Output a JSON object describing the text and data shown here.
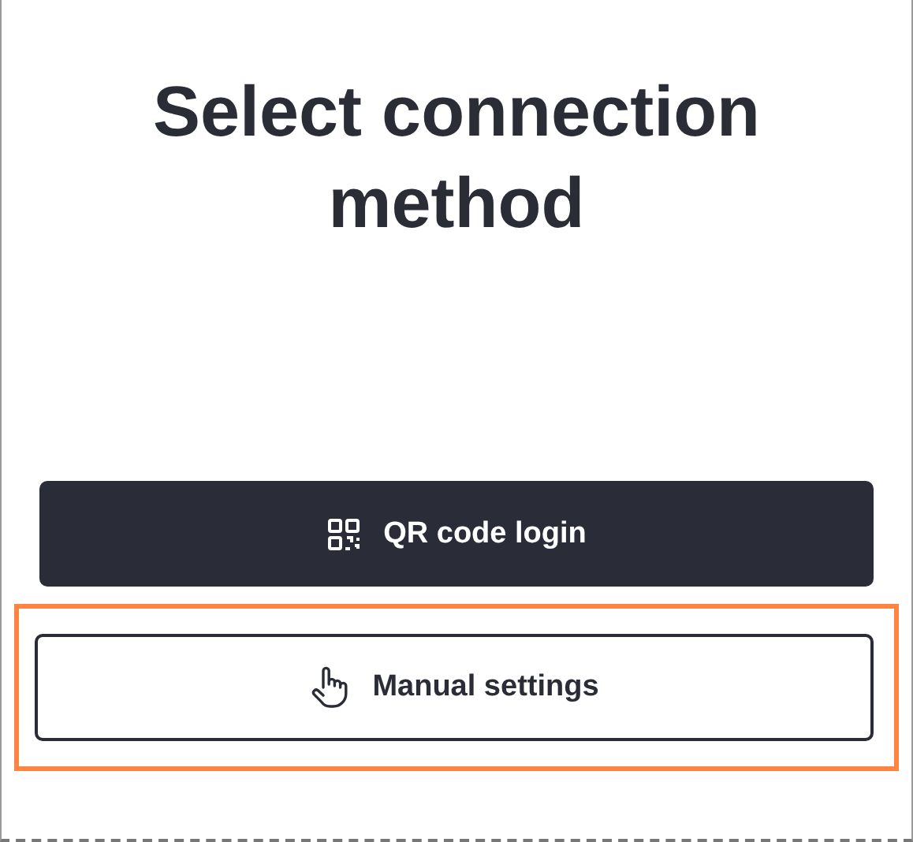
{
  "title": "Select connection method",
  "buttons": [
    {
      "label": "QR code login",
      "kind": "primary",
      "highlighted": false
    },
    {
      "label": "Manual settings",
      "kind": "outline",
      "highlighted": true
    }
  ]
}
